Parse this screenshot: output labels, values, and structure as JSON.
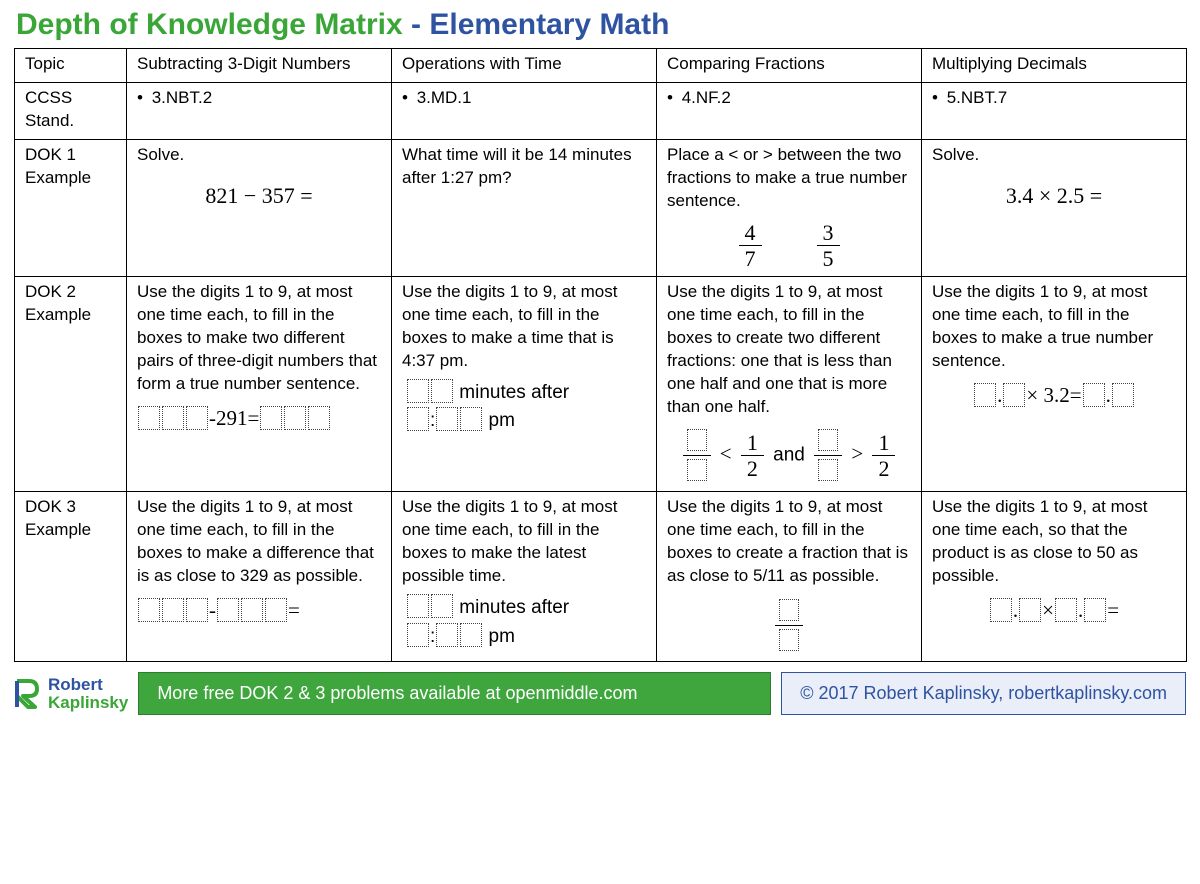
{
  "title": {
    "part1": "Depth of Knowledge Matrix",
    "dash": " - ",
    "part2": "Elementary Math"
  },
  "rowLabels": {
    "topic": "Topic",
    "ccss": "CCSS Stand.",
    "dok1": "DOK 1\nExample",
    "dok2": "DOK 2\nExample",
    "dok3": "DOK 3\nExample"
  },
  "cols": [
    {
      "topic": "Subtracting 3-Digit Numbers",
      "ccss": "3.NBT.2",
      "dok1_text": "Solve.",
      "dok1_math": "821 − 357 =",
      "dok2_text": "Use the digits 1 to 9, at most one time each, to fill in the boxes to make two different pairs of three-digit numbers that form a true number sentence.",
      "dok2_expr_mid": "-291=",
      "dok3_text": "Use the digits 1 to 9, at most one time each, to fill in the boxes to make a difference that is as close to 329 as possible.",
      "dok3_op": "-",
      "dok3_eq": "="
    },
    {
      "topic": "Operations with Time",
      "ccss": "3.MD.1",
      "dok1_text": "What time will it be 14 minutes after 1:27 pm?",
      "dok2_text": "Use the digits 1 to 9, at most one time each, to fill in the boxes to make a time that is 4:37 pm.",
      "time_after": " minutes after",
      "time_pm": " pm",
      "time_colon": ":",
      "dok3_text": "Use the digits 1 to 9, at most one time each, to fill in the boxes to make the latest possible time."
    },
    {
      "topic": "Comparing Fractions",
      "ccss": "4.NF.2",
      "dok1_text": "Place a < or > between the two fractions to make a true number sentence.",
      "frac1_num": "4",
      "frac1_den": "7",
      "frac2_num": "3",
      "frac2_den": "5",
      "dok2_text": "Use the digits 1 to 9, at most one time each, to fill in the boxes to create two different fractions: one that is less than one half and one that is more than one half.",
      "half_num": "1",
      "half_den": "2",
      "lt": "<",
      "gt": ">",
      "and": " and ",
      "dok3_text": "Use the digits 1 to 9, at most one time each, to fill in the boxes to create a fraction that is as close to 5/11 as possible."
    },
    {
      "topic": "Multiplying Decimals",
      "ccss": "5.NBT.7",
      "dok1_text": "Solve.",
      "dok1_math": "3.4  × 2.5 =",
      "dok2_text": "Use the digits 1 to 9, at most one time each, to fill in the boxes to make a true number sentence.",
      "dok2_dot": ".",
      "dok2_mid": "× 3.2=",
      "dok3_text": "Use the digits 1 to 9, at most one time each, so that the product is as close to 50 as possible.",
      "dok3_dot": ".",
      "dok3_times": "×",
      "dok3_eq": "="
    }
  ],
  "footer": {
    "logo_line1": "Robert",
    "logo_line2": "Kaplinsky",
    "banner": "More free DOK 2 & 3 problems available at openmiddle.com",
    "copyright": "© 2017 Robert Kaplinsky, robertkaplinsky.com"
  }
}
